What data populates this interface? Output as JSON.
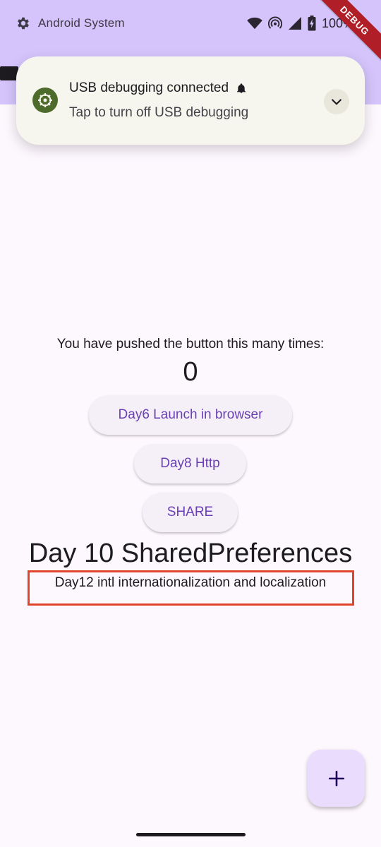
{
  "status_bar": {
    "app_name": "Android System",
    "battery_text": "100%",
    "icons": [
      "gear-icon",
      "wifi-icon",
      "hotspot-icon",
      "signal-icon",
      "battery-icon"
    ]
  },
  "debug_banner": {
    "label": "DEBUG",
    "color": "#b01f28"
  },
  "notification": {
    "title": "USB debugging connected",
    "subtitle": "Tap to turn off USB debugging",
    "icon": "usb-debug-icon",
    "alert_icon": "bell-icon",
    "expand_icon": "chevron-down-icon"
  },
  "main": {
    "counter_label": "You have pushed the button this many times:",
    "counter_value": "0",
    "buttons": [
      {
        "label": "Day6 Launch in browser"
      },
      {
        "label": "Day8 Http"
      },
      {
        "label": "SHARE"
      }
    ],
    "heading": "Day 10 SharedPreferences",
    "highlighted_text": "Day12 intl internationalization and localization",
    "highlight_color": "#e0452b"
  },
  "fab": {
    "icon": "plus-icon"
  },
  "theme": {
    "primary": "#6a3fb5",
    "top_band": "#d4c4fb",
    "background": "#fdf7fe"
  }
}
